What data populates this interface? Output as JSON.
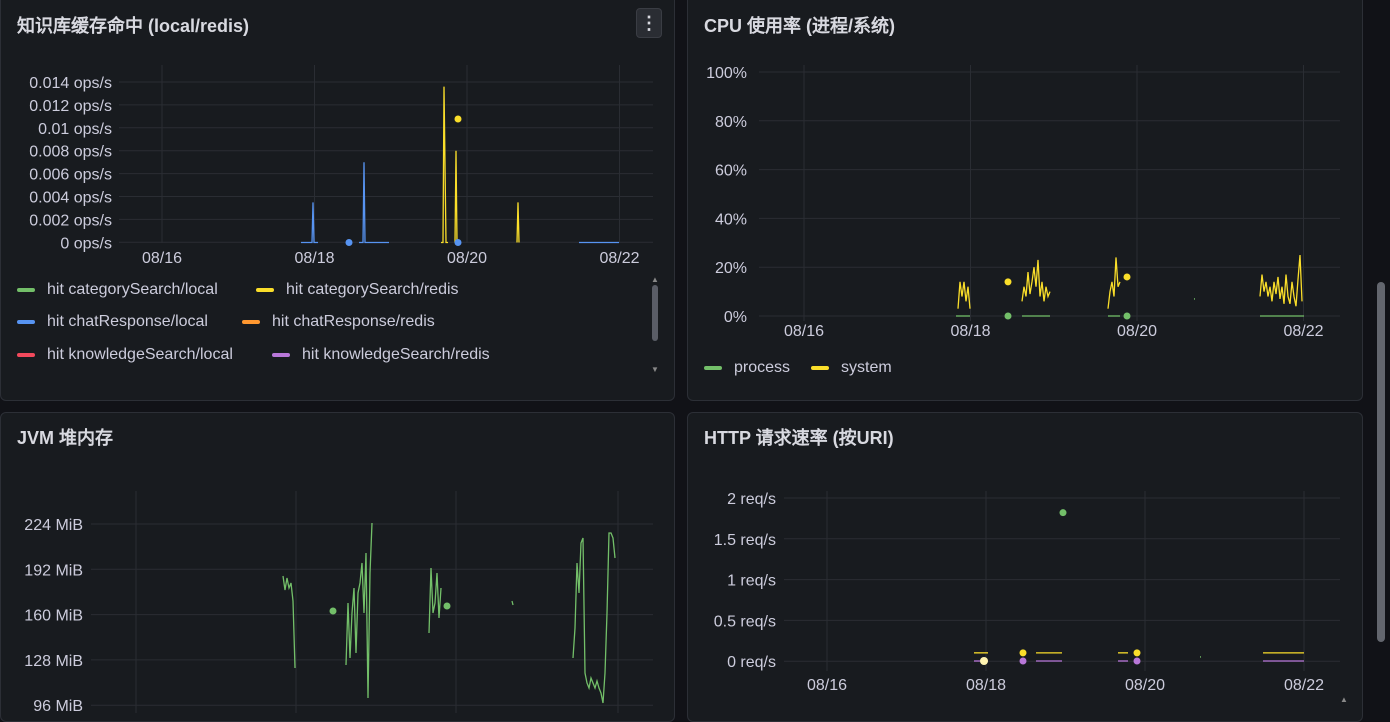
{
  "panels": {
    "cache": {
      "title": "知识库缓存命中 (local/redis)",
      "menu_icon": "⋮",
      "chart_data": {
        "type": "line",
        "ylim": [
          0,
          0.014
        ],
        "yticks": [
          "0.014 ops/s",
          "0.012 ops/s",
          "0.01 ops/s",
          "0.008 ops/s",
          "0.006 ops/s",
          "0.004 ops/s",
          "0.002 ops/s",
          "0 ops/s"
        ],
        "xticks": [
          "08/16",
          "08/18",
          "08/20",
          "08/22"
        ],
        "legend": [
          {
            "name": "hit categorySearch/local",
            "color": "#73bf69"
          },
          {
            "name": "hit categorySearch/redis",
            "color": "#fade2a"
          },
          {
            "name": "hit chatResponse/local",
            "color": "#5794f2"
          },
          {
            "name": "hit chatResponse/redis",
            "color": "#ff9830"
          },
          {
            "name": "hit knowledgeSearch/local",
            "color": "#f2495c"
          },
          {
            "name": "hit knowledgeSearch/redis",
            "color": "#b877d9"
          }
        ],
        "series": [
          {
            "name": "hit chatResponse/local",
            "color": "#5794f2",
            "x": [
              "08/18"
            ],
            "values": [
              0.0035
            ]
          },
          {
            "name": "hit categorySearch/redis",
            "color": "#fade2a",
            "x": [
              "08/18",
              "08/19",
              "08/20",
              "08/21"
            ],
            "values": [
              0.007,
              0.0136,
              0.0105,
              0.0035
            ]
          }
        ]
      }
    },
    "cpu": {
      "title": "CPU 使用率 (进程/系统)",
      "chart_data": {
        "type": "line",
        "ylim": [
          0,
          100
        ],
        "yticks": [
          "100%",
          "80%",
          "60%",
          "40%",
          "20%",
          "0%"
        ],
        "xticks": [
          "08/16",
          "08/18",
          "08/20",
          "08/22"
        ],
        "legend": [
          {
            "name": "process",
            "color": "#73bf69"
          },
          {
            "name": "system",
            "color": "#fade2a"
          }
        ],
        "series": [
          {
            "name": "process",
            "color": "#73bf69",
            "values": [
              0,
              0,
              0,
              0
            ]
          },
          {
            "name": "system",
            "color": "#fade2a",
            "values": [
              14,
              12,
              22,
              16,
              24,
              15
            ]
          }
        ]
      }
    },
    "jvm": {
      "title": "JVM 堆内存",
      "chart_data": {
        "type": "line",
        "yticks": [
          "224 MiB",
          "192 MiB",
          "160 MiB",
          "128 MiB",
          "96 MiB"
        ],
        "ylim": [
          96,
          224
        ],
        "series": [
          {
            "name": "heap",
            "color": "#73bf69",
            "values": [
              190,
              120,
              165,
              228,
              200,
              168,
              220
            ]
          }
        ]
      }
    },
    "http": {
      "title": "HTTP 请求速率 (按URI)",
      "chart_data": {
        "type": "line",
        "ylim": [
          0,
          2
        ],
        "yticks": [
          "2 req/s",
          "1.5 req/s",
          "1 req/s",
          "0.5 req/s",
          "0 req/s"
        ],
        "xticks": [
          "08/16",
          "08/18",
          "08/20",
          "08/22"
        ],
        "series": [
          {
            "name": "green",
            "color": "#73bf69",
            "values": [
              1.82
            ]
          },
          {
            "name": "yellow",
            "color": "#fade2a",
            "values": [
              0.1,
              0.1,
              0.1
            ]
          },
          {
            "name": "purple",
            "color": "#b877d9",
            "values": [
              0,
              0,
              0
            ]
          }
        ]
      }
    }
  }
}
